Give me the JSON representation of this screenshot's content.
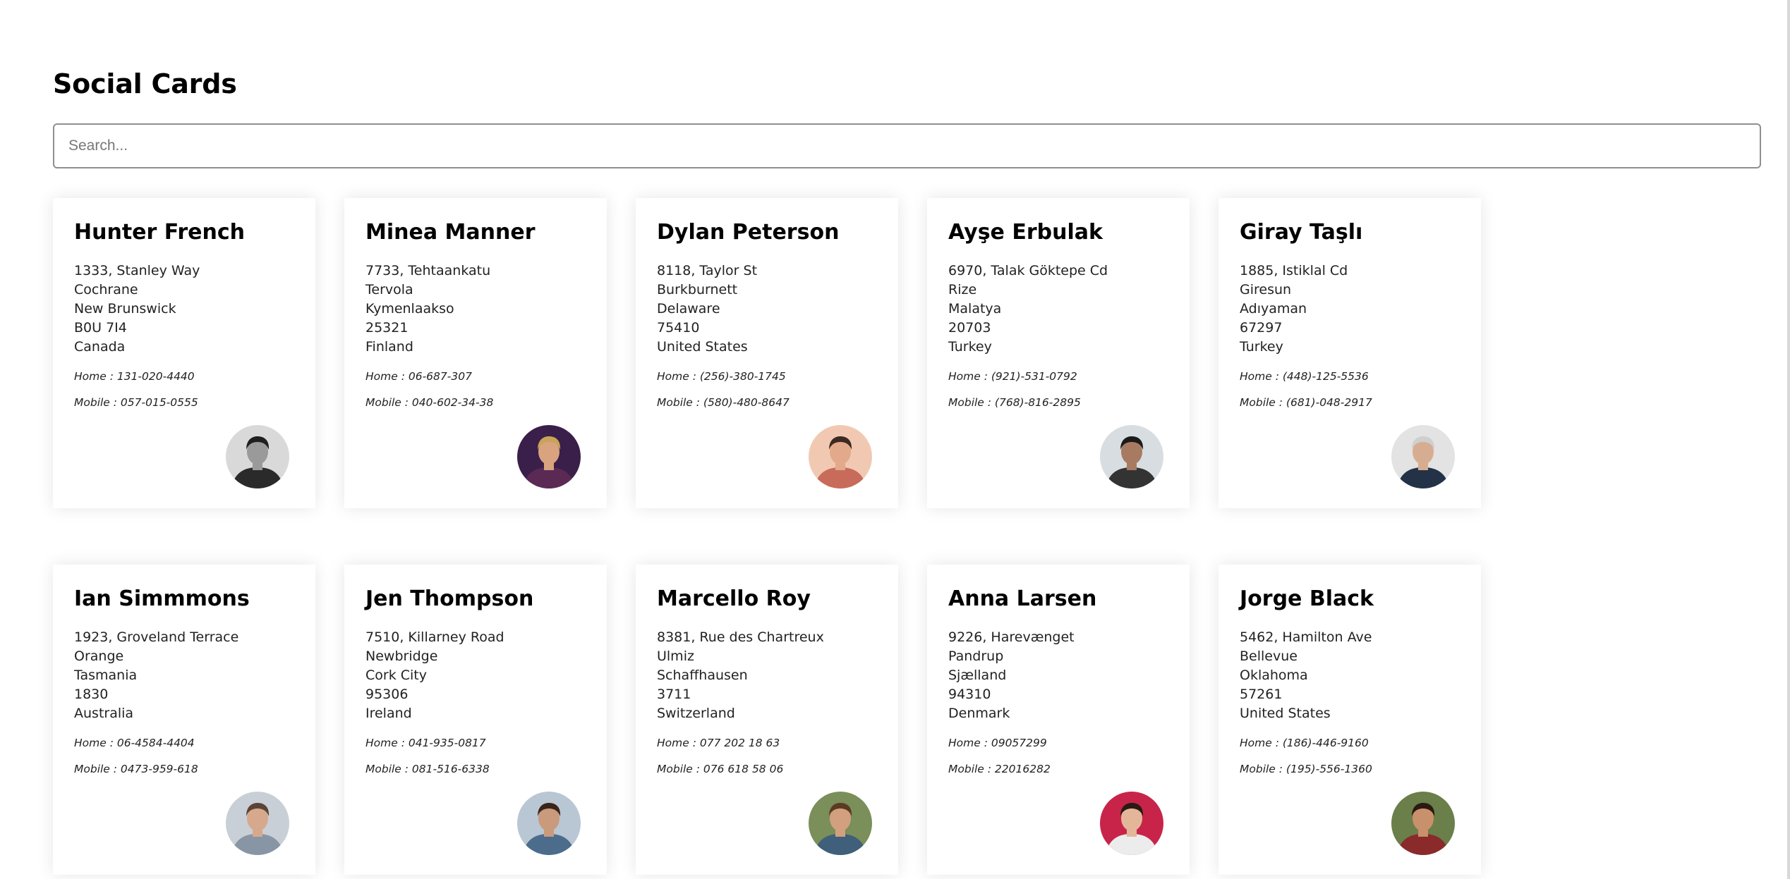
{
  "page": {
    "title": "Social Cards",
    "search_placeholder": "Search..."
  },
  "cards": [
    {
      "name": "Hunter French",
      "address": [
        "1333, Stanley Way",
        "Cochrane",
        "New Brunswick",
        "B0U 7I4",
        "Canada"
      ],
      "home": "Home : 131-020-4440",
      "mobile": "Mobile : 057-015-0555",
      "avatar": {
        "bg": "#d9d9d9",
        "skin": "#9a9a9a",
        "hair": "#1f1f1f",
        "shirt": "#2a2a2a"
      }
    },
    {
      "name": "Minea Manner",
      "address": [
        "7733, Tehtaankatu",
        "Tervola",
        "Kymenlaakso",
        "25321",
        "Finland"
      ],
      "home": "Home : 06-687-307",
      "mobile": "Mobile : 040-602-34-38",
      "avatar": {
        "bg": "#3a1f4a",
        "skin": "#d8a37e",
        "hair": "#c9a35a",
        "shirt": "#5a2a55"
      }
    },
    {
      "name": "Dylan Peterson",
      "address": [
        "8118, Taylor St",
        "Burkburnett",
        "Delaware",
        "75410",
        "United States"
      ],
      "home": "Home : (256)-380-1745",
      "mobile": "Mobile : (580)-480-8647",
      "avatar": {
        "bg": "#f1c9b3",
        "skin": "#e2aa8a",
        "hair": "#3a2a22",
        "shirt": "#c86b5a"
      }
    },
    {
      "name": "Ayşe Erbulak",
      "address": [
        "6970, Talak Göktepe Cd",
        "Rize",
        "Malatya",
        "20703",
        "Turkey"
      ],
      "home": "Home : (921)-531-0792",
      "mobile": "Mobile : (768)-816-2895",
      "avatar": {
        "bg": "#d7dde0",
        "skin": "#a87a62",
        "hair": "#1b1b1b",
        "shirt": "#333333"
      }
    },
    {
      "name": "Giray Taşlı",
      "address": [
        "1885, Istiklal Cd",
        "Giresun",
        "Adıyaman",
        "67297",
        "Turkey"
      ],
      "home": "Home : (448)-125-5536",
      "mobile": "Mobile : (681)-048-2917",
      "avatar": {
        "bg": "#e3e3e3",
        "skin": "#d7ad92",
        "hair": "#cfcfcf",
        "shirt": "#243247"
      }
    },
    {
      "name": "Ian Simmmons",
      "address": [
        "1923, Groveland Terrace",
        "Orange",
        "Tasmania",
        "1830",
        "Australia"
      ],
      "home": "Home : 06-4584-4404",
      "mobile": "Mobile : 0473-959-618",
      "avatar": {
        "bg": "#c9cfd6",
        "skin": "#d6a98c",
        "hair": "#5b4436",
        "shirt": "#8895a5"
      }
    },
    {
      "name": "Jen Thompson",
      "address": [
        "7510, Killarney Road",
        "Newbridge",
        "Cork City",
        "95306",
        "Ireland"
      ],
      "home": "Home : 041-935-0817",
      "mobile": "Mobile : 081-516-6338",
      "avatar": {
        "bg": "#b9c6d3",
        "skin": "#c99a7c",
        "hair": "#3a2418",
        "shirt": "#4c6c8c"
      }
    },
    {
      "name": "Marcello Roy",
      "address": [
        "8381, Rue des Chartreux",
        "Ulmiz",
        "Schaffhausen",
        "3711",
        "Switzerland"
      ],
      "home": "Home : 077 202 18 63",
      "mobile": "Mobile : 076 618 58 06",
      "avatar": {
        "bg": "#7a8f5a",
        "skin": "#d2a07e",
        "hair": "#5a3a22",
        "shirt": "#3f5f7a"
      }
    },
    {
      "name": "Anna Larsen",
      "address": [
        "9226, Harevænget",
        "Pandrup",
        "Sjælland",
        "94310",
        "Denmark"
      ],
      "home": "Home : 09057299",
      "mobile": "Mobile : 22016282",
      "avatar": {
        "bg": "#c8244a",
        "skin": "#e3b69a",
        "hair": "#2a1a14",
        "shirt": "#ececec"
      }
    },
    {
      "name": "Jorge Black",
      "address": [
        "5462, Hamilton Ave",
        "Bellevue",
        "Oklahoma",
        "57261",
        "United States"
      ],
      "home": "Home : (186)-446-9160",
      "mobile": "Mobile : (195)-556-1360",
      "avatar": {
        "bg": "#6a7f4a",
        "skin": "#c9906c",
        "hair": "#2a1a12",
        "shirt": "#8a2a2a"
      }
    }
  ]
}
